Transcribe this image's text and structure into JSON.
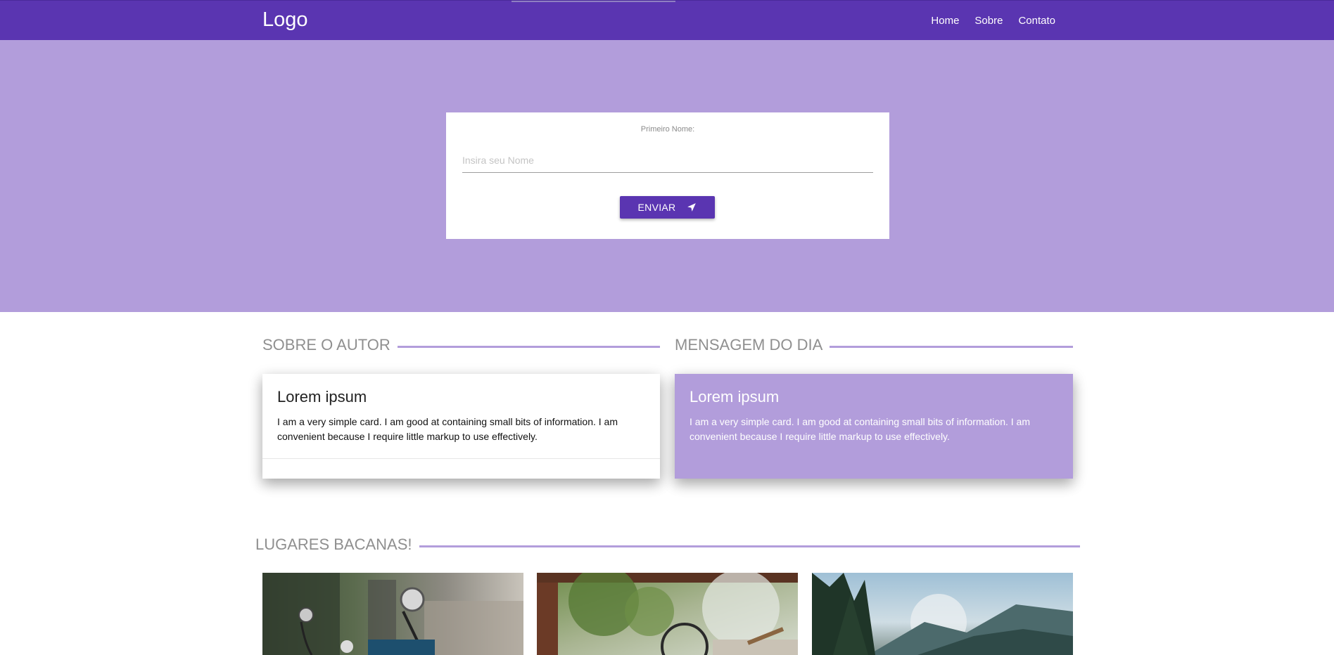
{
  "nav": {
    "logo": "Logo",
    "links": [
      "Home",
      "Sobre",
      "Contato"
    ]
  },
  "form": {
    "label": "Primeiro Nome:",
    "placeholder": "Insira seu Nome",
    "value": "",
    "button_label": "ENVIAR",
    "button_icon": "send-icon"
  },
  "sections": {
    "about": "SOBRE O AUTOR",
    "message": "MENSAGEM DO DIA",
    "places": "LUGARES BACANAS!"
  },
  "cards": [
    {
      "title": "Lorem ipsum",
      "text": "I am a very simple card. I am good at containing small bits of information. I am convenient because I require little markup to use effectively."
    },
    {
      "title": "Lorem ipsum",
      "text": "I am a very simple card. I am good at containing small bits of information. I am convenient because I require little markup to use effectively."
    }
  ],
  "images": [
    "motorcycle-photo",
    "vintage-van-photo",
    "mountain-landscape-photo"
  ],
  "colors": {
    "primary": "#5a35b1",
    "primary_light": "#b29ddb",
    "section_title": "#8f8f8f"
  }
}
